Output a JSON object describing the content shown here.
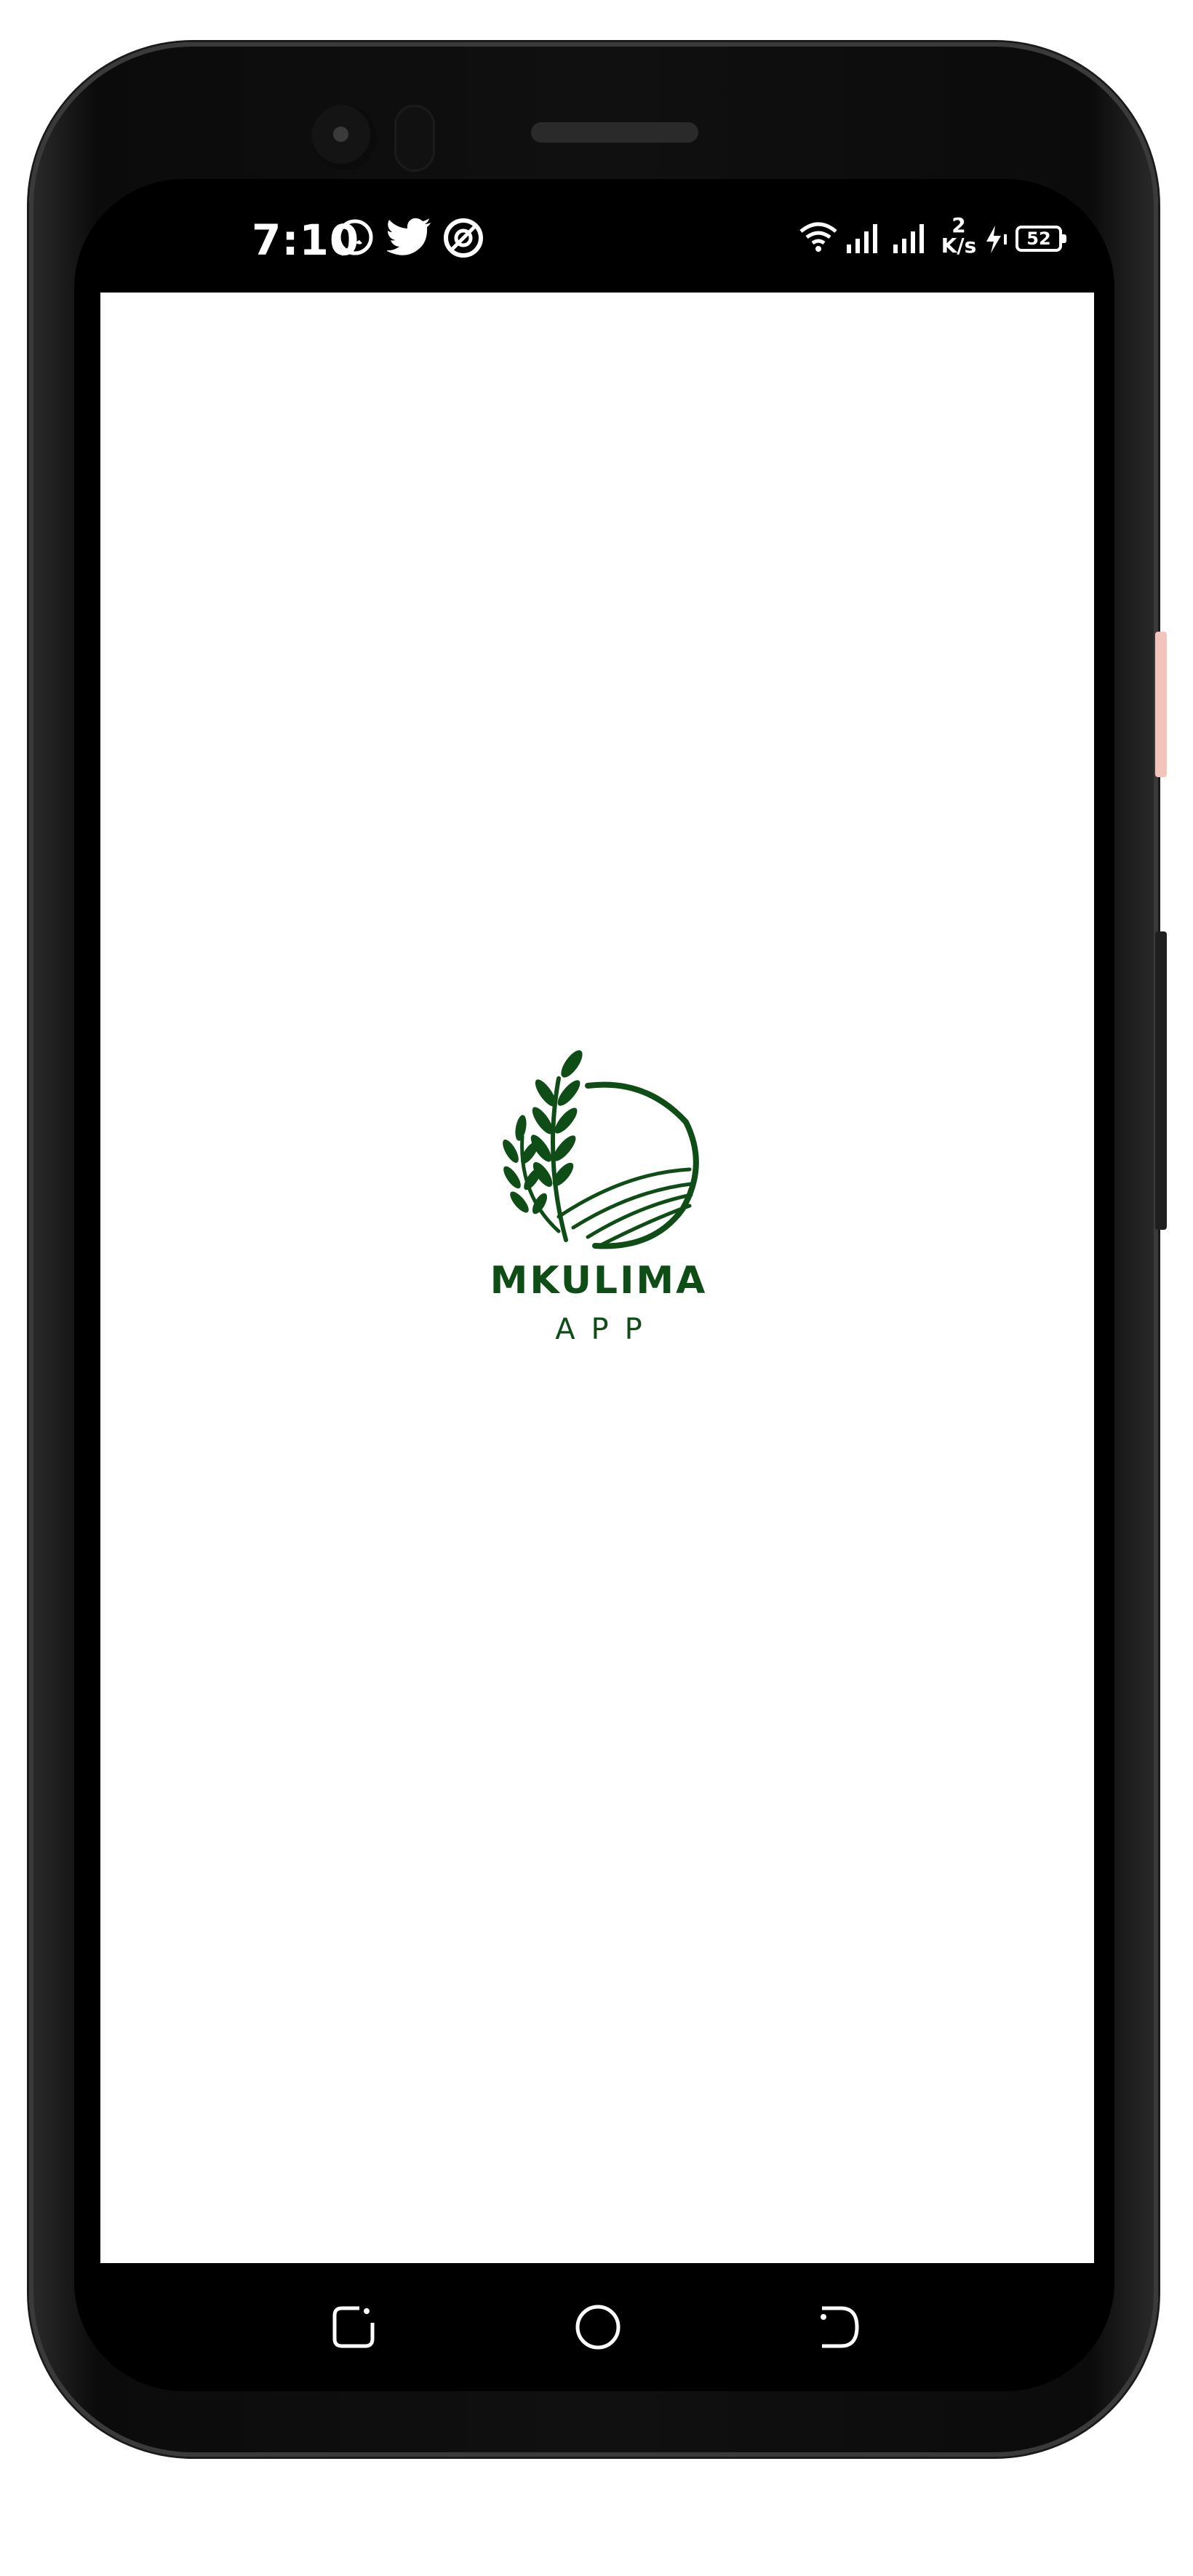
{
  "status_bar": {
    "time": "7:10",
    "notification_icons": [
      "whatsapp-icon",
      "twitter-icon",
      "at-sign-icon"
    ],
    "system_icons": [
      "wifi-icon",
      "signal-icon",
      "signal-icon",
      "data-speed",
      "charging-icon",
      "battery-icon"
    ],
    "network_speed_value": "2",
    "network_speed_unit": "K/s",
    "battery_level": "52"
  },
  "splash": {
    "brand_name": "MKULIMA",
    "brand_subtitle": "APP",
    "logo_color": "#0f4d16"
  },
  "navigation_bar": {
    "buttons": [
      "recent-apps",
      "home",
      "back"
    ]
  },
  "colors": {
    "screen_background": "#ffffff",
    "status_bar_background": "#000000",
    "brand_green": "#0f4d16"
  }
}
